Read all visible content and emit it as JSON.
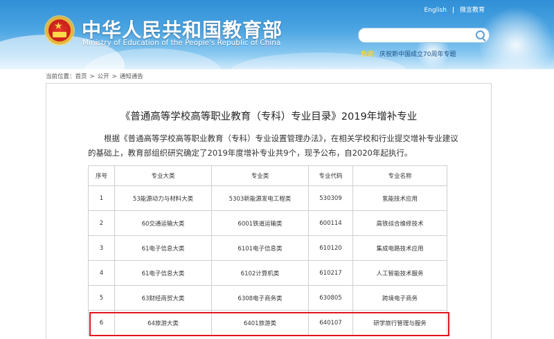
{
  "header": {
    "title": "中华人民共和国教育部",
    "subtitle": "Ministry of Education of the People's Republic of China",
    "links": [
      {
        "label": "English"
      },
      {
        "label": "微言教育"
      }
    ],
    "search": {
      "value": "",
      "placeholder": ""
    },
    "hot": {
      "label": "热词：",
      "link": "庆祝新中国成立70周年专题"
    }
  },
  "breadcrumb": {
    "prefix": "当前位置：",
    "items": [
      "首页",
      "公开",
      "通知通告"
    ],
    "separator": ">"
  },
  "article": {
    "title": "《普通高等学校高等职业教育（专科）专业目录》2019年增补专业",
    "intro": "根据《普通高等学校高等职业教育（专科）专业设置管理办法》，在相关学校和行业提交增补专业建议的基础上，教育部组织研究确定了2019年度增补专业共9个，现予公布，自2020年起执行。"
  },
  "table": {
    "headers": [
      "序号",
      "专业大类",
      "专业类",
      "专业代码",
      "专业名称"
    ],
    "rows": [
      [
        "1",
        "53能源动力与材料大类",
        "5303新能源发电工程类",
        "530309",
        "氢能技术应用"
      ],
      [
        "2",
        "60交通运输大类",
        "6001铁道运输类",
        "600114",
        "高铁综合维修技术"
      ],
      [
        "3",
        "61电子信息大类",
        "6101电子信息类",
        "610120",
        "集成电路技术应用"
      ],
      [
        "4",
        "61电子信息大类",
        "6102计算机类",
        "610217",
        "人工智能技术服务"
      ],
      [
        "5",
        "63财经商贸大类",
        "6308电子商务类",
        "630805",
        "跨境电子商务"
      ],
      [
        "6",
        "64旅游大类",
        "6401旅游类",
        "640107",
        "研学旅行管理与服务"
      ]
    ],
    "highlighted_row_index": 5,
    "highlight_color": "#e3141b"
  },
  "colors": {
    "header_blue": "#2f8fd6",
    "hot_label": "#ffd23c",
    "hot_link": "#1d4f86"
  }
}
